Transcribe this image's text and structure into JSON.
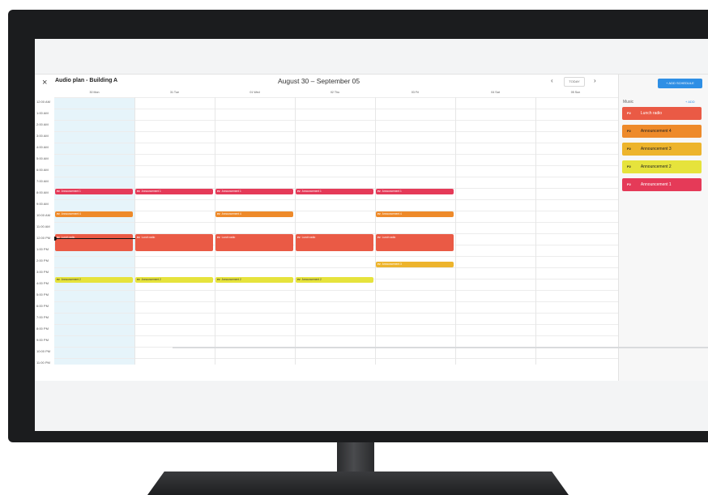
{
  "header": {
    "close_icon": "×",
    "plan_title": "Audio plan - Building A",
    "date_range": "August 30 – September 05",
    "prev_icon": "‹",
    "today_label": "TODAY",
    "next_icon": "›"
  },
  "days": [
    "30 Mon",
    "31 Tue",
    "01 Wed",
    "02 Thu",
    "03 Fri",
    "04 Sat",
    "05 Sun"
  ],
  "times": [
    "12:00 AM",
    "1:00 AM",
    "2:00 AM",
    "3:00 AM",
    "4:00 AM",
    "5:00 AM",
    "6:00 AM",
    "7:00 AM",
    "8:00 AM",
    "9:00 AM",
    "10:00 AM",
    "11:00 AM",
    "12:00 PM",
    "1:00 PM",
    "2:00 PM",
    "3:00 PM",
    "4:00 PM",
    "5:00 PM",
    "6:00 PM",
    "7:00 PM",
    "8:00 PM",
    "9:00 PM",
    "10:00 PM",
    "11:00 PM"
  ],
  "events": {
    "e1": {
      "icon": "P2",
      "label": "Announcement 1"
    },
    "e2": {
      "icon": "P2",
      "label": "Announcement 4"
    },
    "e3": {
      "icon": "P2",
      "label": "Lunch radio"
    },
    "e4": {
      "icon": "P2",
      "label": "Announcement 3"
    },
    "e5": {
      "icon": "P2",
      "label": "Announcement 2"
    }
  },
  "sidebar": {
    "add_schedule": "+ ADD SCHEDULE",
    "section_label": "Music",
    "add_label": "+ ADD",
    "items": [
      {
        "icon": "P2",
        "label": "Lunch radio",
        "color": "#ea5a45"
      },
      {
        "icon": "P2",
        "label": "Announcement 4",
        "color": "#ee8a2a"
      },
      {
        "icon": "P2",
        "label": "Announcement 3",
        "color": "#edb42c"
      },
      {
        "icon": "P2",
        "label": "Announcement 2",
        "color": "#e6e33c"
      },
      {
        "icon": "P2",
        "label": "Announcement 1",
        "color": "#e53a58"
      }
    ]
  },
  "colors": {
    "announcement_1": "#e53a58",
    "announcement_4": "#ee8a2a",
    "lunch_radio": "#ea5a45",
    "announcement_3": "#edb42c",
    "announcement_2": "#e6e33c",
    "accent": "#2f8fe5"
  }
}
